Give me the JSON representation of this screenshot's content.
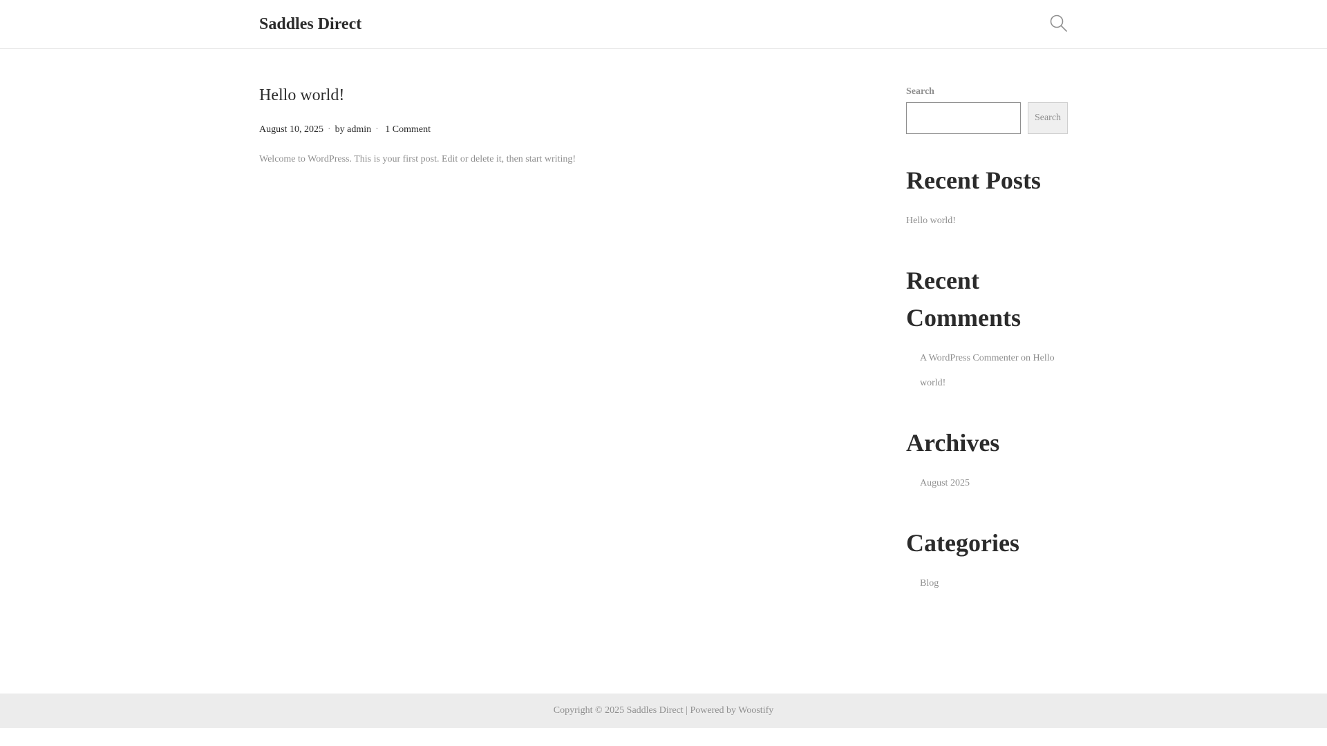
{
  "header": {
    "site_title": "Saddles Direct",
    "search_icon": "search-icon"
  },
  "post": {
    "title": "Hello world!",
    "date": "August 10, 2025",
    "separator": "·",
    "by_prefix": "by",
    "author": "admin",
    "comments": "1 Comment",
    "excerpt": "Welcome to WordPress. This is your first post. Edit or delete it, then start writing!"
  },
  "sidebar": {
    "search_label": "Search",
    "search_placeholder": "",
    "search_button": "Search",
    "recent_posts_title": "Recent Posts",
    "recent_posts": [
      "Hello world!"
    ],
    "recent_comments_title_line1": "Recent",
    "recent_comments_title_line2": "Comments",
    "recent_comment": {
      "author": "A WordPress Commenter",
      "on": "on",
      "post": "Hello world!"
    },
    "archives_title": "Archives",
    "archives": [
      "August 2025"
    ],
    "categories_title": "Categories",
    "categories": [
      "Blog"
    ]
  },
  "footer": {
    "copyright": "Copyright © 2025 Saddles Direct",
    "divider": "|",
    "powered_prefix": "Powered by",
    "powered_link": "Woostify"
  },
  "colors": {
    "text": "#2b2b2b",
    "muted": "#8f8f8f",
    "footer_bg": "#ececec",
    "border": "#e6e6e6"
  }
}
